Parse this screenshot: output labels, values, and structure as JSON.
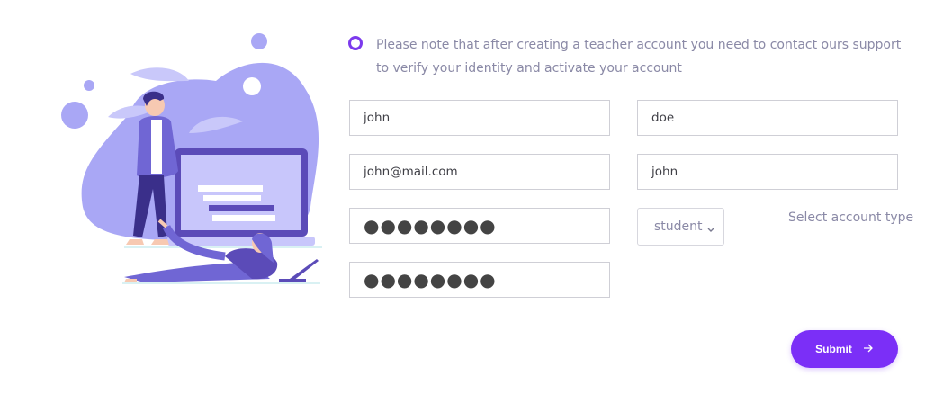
{
  "note": {
    "text": "Please note that after creating a teacher account you need to contact ours support to verify your identity and activate your account"
  },
  "form": {
    "first_name": "john",
    "last_name": "doe",
    "email": "john@mail.com",
    "username": "john",
    "password": "●●●●●●●●",
    "password_confirm": "●●●●●●●●",
    "account_type": {
      "selected": "student",
      "label": "Select account type"
    }
  },
  "submit": {
    "label": "Submit",
    "icon": "arrow-right-icon"
  },
  "colors": {
    "accent": "#7b2ff7",
    "illustration": "#a9a7f5",
    "text_muted": "#8a89a6"
  }
}
